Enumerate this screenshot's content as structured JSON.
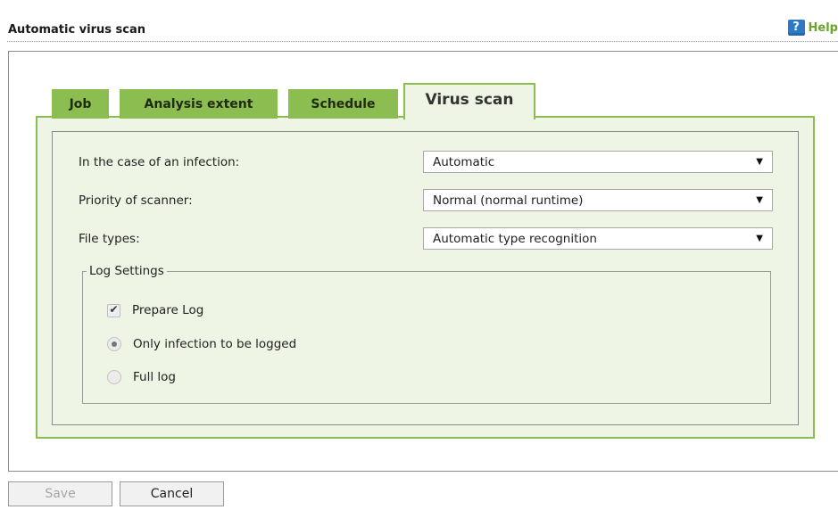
{
  "header": {
    "title": "Automatic virus scan",
    "help_label": "Help",
    "help_icon": "?"
  },
  "tabs": [
    {
      "label": "Job",
      "active": false
    },
    {
      "label": "Analysis extent",
      "active": false
    },
    {
      "label": "Schedule",
      "active": false
    },
    {
      "label": "Virus scan",
      "active": true
    }
  ],
  "form": {
    "infection": {
      "label": "In the case of an infection:",
      "value": "Automatic"
    },
    "priority": {
      "label": "Priority of scanner:",
      "value": "Normal (normal runtime)"
    },
    "file_types": {
      "label": "File types:",
      "value": "Automatic type recognition"
    }
  },
  "log_settings": {
    "legend": "Log Settings",
    "prepare_log": {
      "label": "Prepare Log",
      "checked": true
    },
    "options": [
      {
        "label": "Only infection to be logged",
        "selected": true
      },
      {
        "label": "Full log",
        "selected": false
      }
    ]
  },
  "buttons": {
    "save": "Save",
    "cancel": "Cancel"
  },
  "colors": {
    "tab_green": "#8cbd50",
    "panel_bg": "#eef5e4",
    "help_blue": "#2c79c7",
    "help_text": "#6aa52b"
  },
  "icons": {
    "caret": "▼",
    "check": "✔"
  }
}
